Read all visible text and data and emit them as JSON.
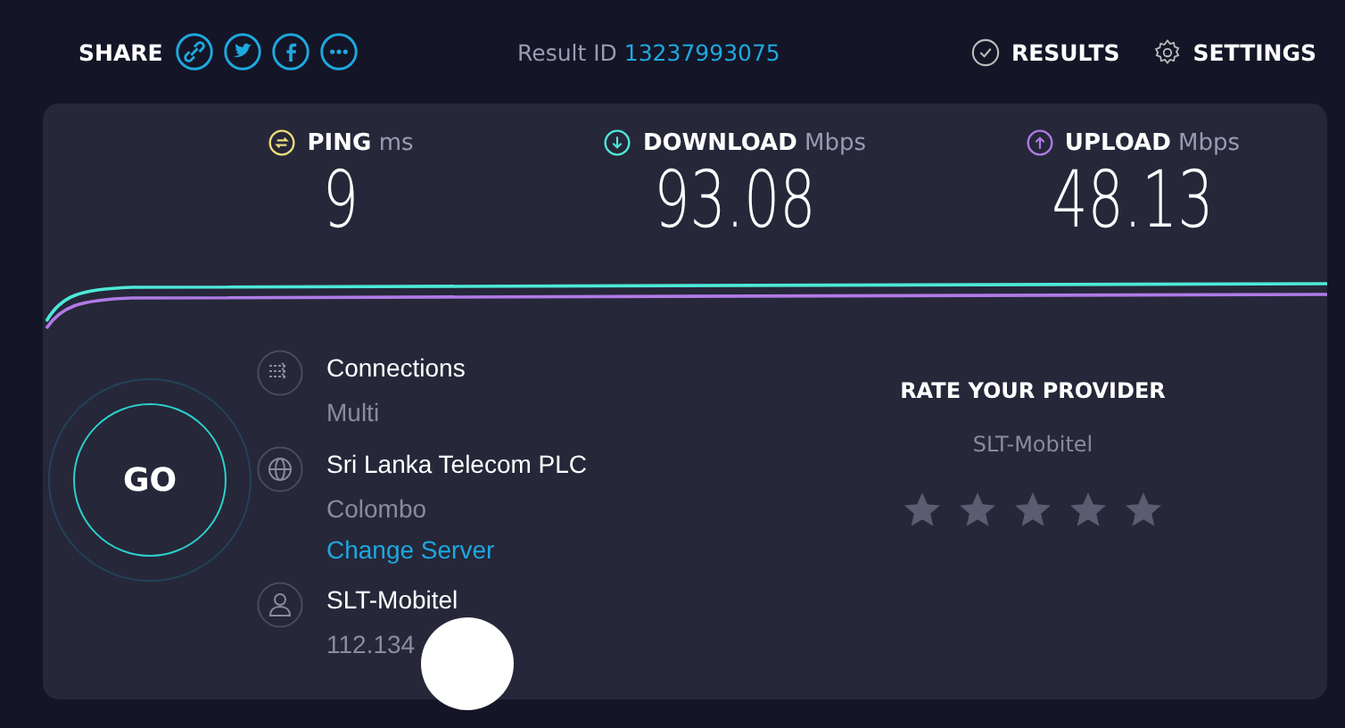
{
  "top_bar": {
    "share_label": "SHARE",
    "result_label": "Result ID",
    "result_id": "13237993075",
    "nav": [
      {
        "kind": "results",
        "label": "RESULTS"
      },
      {
        "kind": "settings",
        "label": "SETTINGS"
      }
    ]
  },
  "metrics": [
    {
      "kind": "ping",
      "label": "PING",
      "unit": "ms",
      "value": "9",
      "color": "#ebdc7a"
    },
    {
      "kind": "download",
      "label": "DOWNLOAD",
      "unit": "Mbps",
      "value": "93.08",
      "color": "#4de8d8"
    },
    {
      "kind": "upload",
      "label": "UPLOAD",
      "unit": "Mbps",
      "value": "48.13",
      "color": "#b07ae6"
    }
  ],
  "go_button": "GO",
  "info": [
    {
      "kind": "connections",
      "title": "Connections",
      "lines": [
        "Multi"
      ]
    },
    {
      "kind": "server",
      "title": "Sri Lanka Telecom PLC",
      "lines": [
        "Colombo"
      ],
      "link": "Change Server"
    },
    {
      "kind": "provider",
      "title": "SLT-Mobitel",
      "lines": [
        "112.134"
      ]
    }
  ],
  "rating": {
    "title": "RATE YOUR PROVIDER",
    "provider": "SLT-Mobitel",
    "stars": 0
  }
}
